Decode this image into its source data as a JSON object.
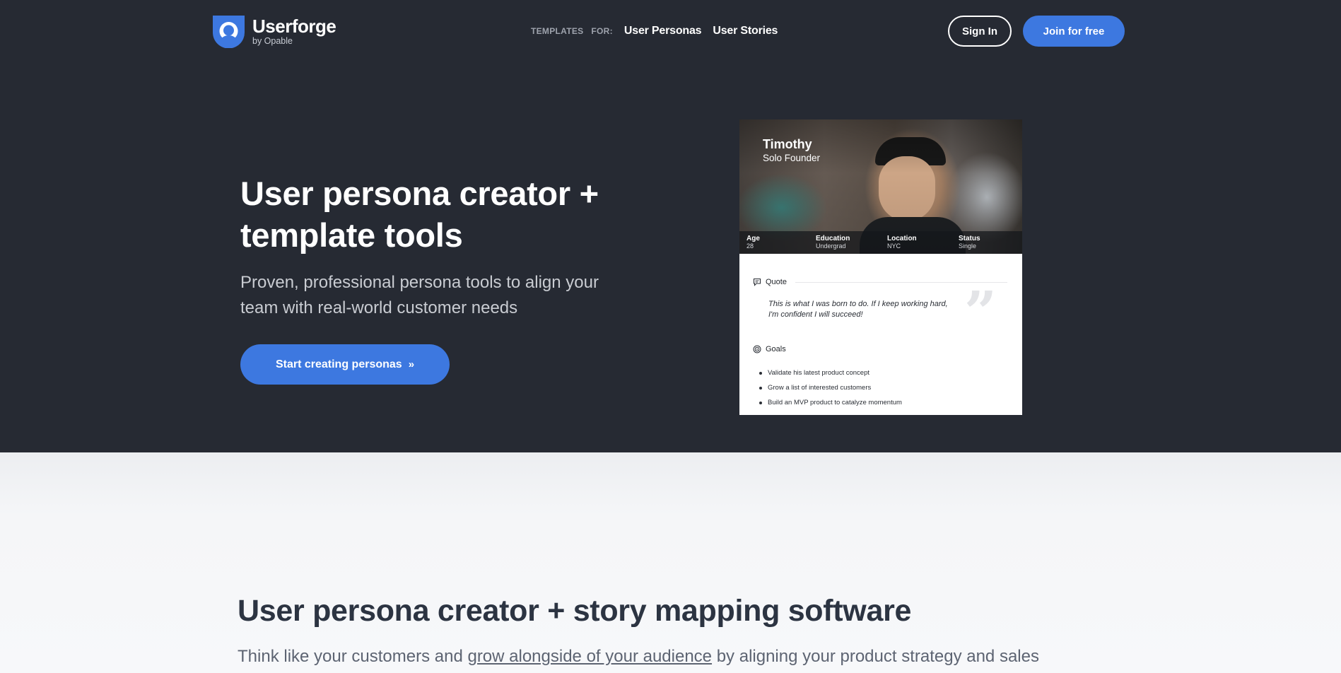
{
  "header": {
    "logo": {
      "name": "Userforge",
      "sub": "by Opable"
    },
    "nav": {
      "templates_label": "TEMPLATES   FOR:",
      "links": [
        "User Personas",
        "User Stories"
      ]
    },
    "sign_in": "Sign In",
    "join": "Join for free"
  },
  "hero": {
    "title": "User persona creator + template tools",
    "subtitle": "Proven, professional persona tools to align your team with real-world customer needs",
    "cta": "Start creating personas",
    "cta_arrow": "»"
  },
  "persona_card": {
    "name": "Timothy",
    "role": "Solo Founder",
    "stats": [
      {
        "key": "Age",
        "value": "28"
      },
      {
        "key": "Education",
        "value": "Undergrad"
      },
      {
        "key": "Location",
        "value": "NYC"
      },
      {
        "key": "Status",
        "value": "Single"
      }
    ],
    "quote_label": "Quote",
    "quote": "This is what I was born to do. If I keep working hard, I'm confident I will succeed!",
    "goals_label": "Goals",
    "goals": [
      "Validate his latest product concept",
      "Grow a list of interested customers",
      "Build an MVP product to catalyze momentum"
    ]
  },
  "section2": {
    "title": "User persona creator + story mapping software",
    "text_before": "Think like your customers and ",
    "link": "grow alongside of your audience",
    "text_after": " by aligning your product strategy and sales"
  },
  "colors": {
    "hero_bg": "#262a33",
    "accent": "#3d78e0",
    "light_bg": "#f4f5f7"
  },
  "icons": [
    "user-shield-logo-icon",
    "chat-icon",
    "target-icon",
    "quote-mark-icon"
  ]
}
